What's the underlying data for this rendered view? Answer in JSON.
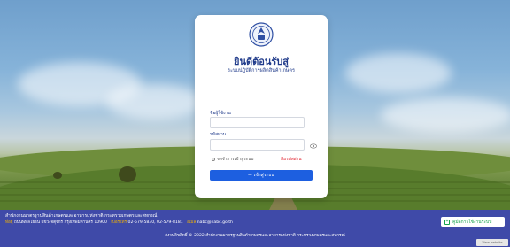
{
  "login": {
    "welcome": "ยินดีต้อนรับสู่",
    "system": "ระบบปฏิบัติการผลิตสินค้าเกษตร",
    "username_label": "ชื่อผู้ใช้งาน",
    "username_value": "",
    "password_label": "รหัสผ่าน",
    "password_value": "",
    "remember_label": "จดจำการเข้าสู่ระบบ",
    "forgot_label": "ลืมรหัสผ่าน",
    "login_button": "เข้าสู่ระบบ"
  },
  "footer": {
    "org_name": "สำนักงานมาตรฐานสินค้าเกษตรและอาหารแห่งชาติ กระทรวงเกษตรและสหกรณ์",
    "address_key": "ที่อยู่",
    "address": "ถนนพหลโยธิน แขวงจตุจักร กรุงเทพมหานคร 10900",
    "phone_key": "เบอร์โทร",
    "phone": "02-579-5830, 02-579-8181",
    "email_key": "อีเมล",
    "email": "nabc@nabc.go.th",
    "manual_button": "คู่มือการใช้งานระบบ",
    "copyright": "สงวนลิขสิทธิ์ © 2022 สำนักงานมาตรฐานสินค้าเกษตรและอาหารแห่งชาติ กระทรวงเกษตรและสหกรณ์",
    "badge": "View website"
  },
  "colors": {
    "primary": "#1d5fe0",
    "title": "#1f3a8a",
    "footer_bg": "#3f4aa8",
    "danger": "#e11d2a",
    "success": "#16a34a"
  }
}
